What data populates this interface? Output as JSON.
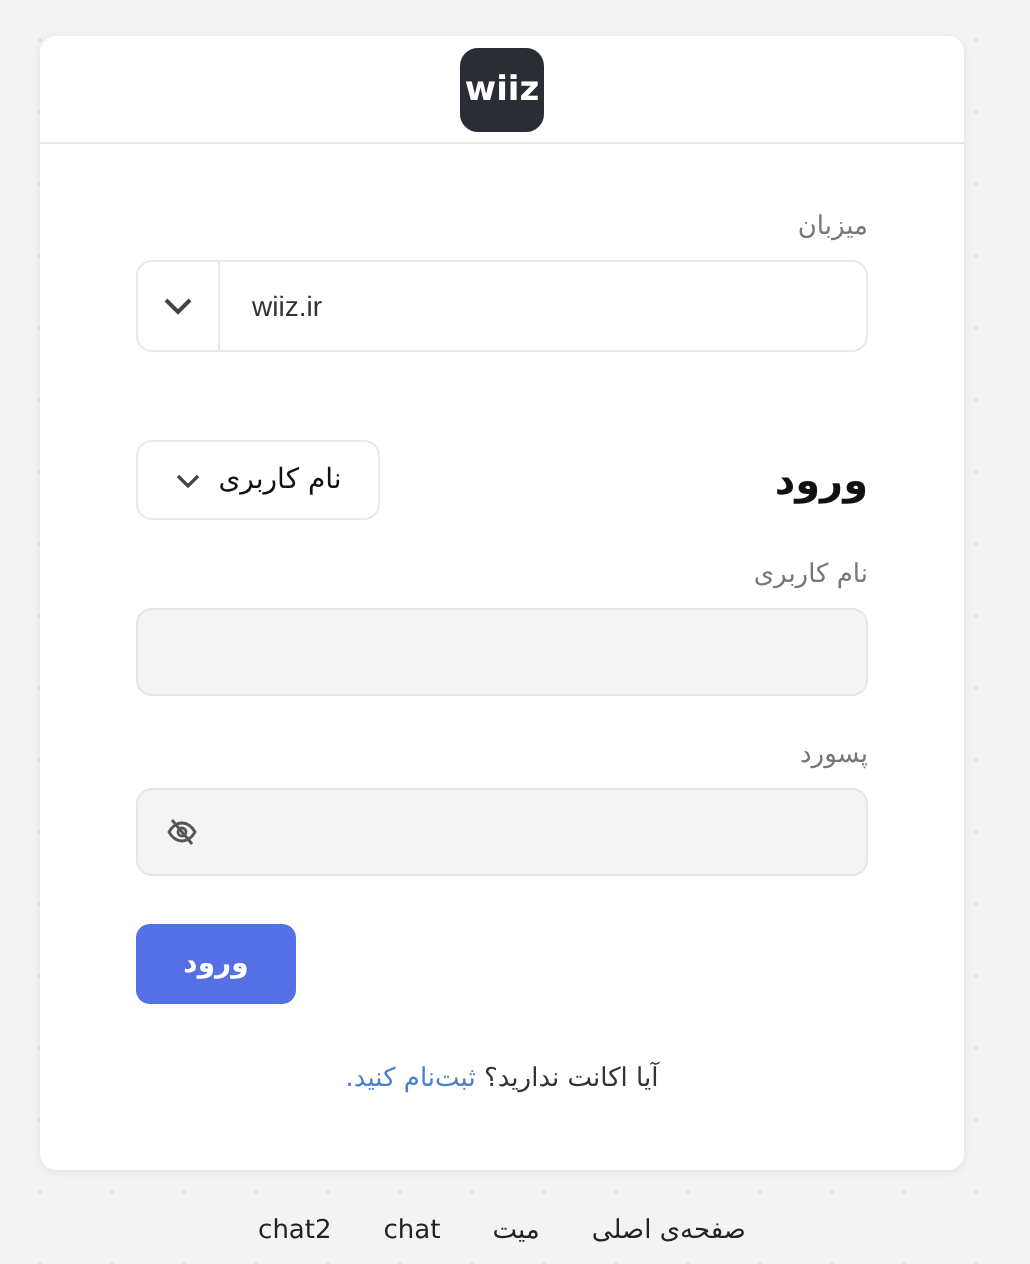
{
  "logo": {
    "text": "wiiz"
  },
  "host": {
    "label": "میزبان",
    "value": "wiiz.ir"
  },
  "login": {
    "title": "ورود",
    "method": "نام کاربری"
  },
  "fields": [
    {
      "label": "نام کاربری",
      "kind": "text"
    },
    {
      "label": "پسورد",
      "kind": "password"
    }
  ],
  "submit": "ورود",
  "signup": {
    "text": "آیا اکانت ندارید؟",
    "link": "ثبت‌نام کنید."
  },
  "footer_links": [
    "صفحه‌ی اصلی",
    "میت",
    "chat",
    "chat2"
  ]
}
